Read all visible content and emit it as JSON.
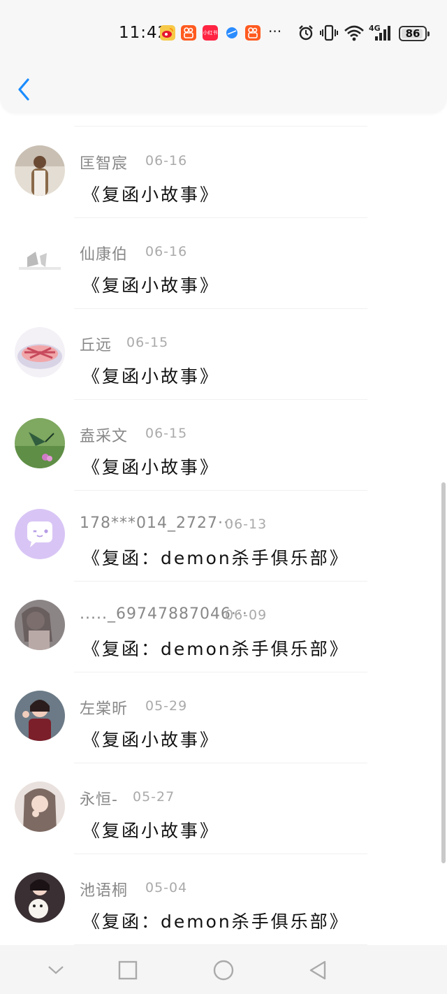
{
  "status_bar": {
    "time": "11:42",
    "app_icons": [
      {
        "name": "weibo-icon",
        "color": "#f5c518"
      },
      {
        "name": "kuaishou-icon",
        "color": "#ff5a1f"
      },
      {
        "name": "xiaohongshu-icon",
        "color": "#ff2442",
        "label": "小红书"
      },
      {
        "name": "browser-icon",
        "color": "#2b8cff"
      },
      {
        "name": "kuaishou-icon",
        "color": "#ff5a1f"
      }
    ],
    "more": "···",
    "network": "4G",
    "battery": "86"
  },
  "header": {
    "back_icon": "chevron-left-icon",
    "accent": "#1a8cff"
  },
  "list": {
    "items": [
      {
        "name": "匡智宸",
        "date": "06-16",
        "title": "《复函小故事》",
        "avatar": "woman-photo"
      },
      {
        "name": "仙康伯",
        "date": "06-16",
        "title": "《复函小故事》",
        "avatar": "landscape-photo"
      },
      {
        "name": "丘远",
        "date": "06-15",
        "title": "《复函小故事》",
        "avatar": "food-photo"
      },
      {
        "name": "盍采文",
        "date": "06-15",
        "title": "《复函小故事》",
        "avatar": "bird-photo"
      },
      {
        "name": "178***014_2727···",
        "date": "06-13",
        "title": "《复函：demon杀手俱乐部》",
        "avatar": "default-chat-avatar"
      },
      {
        "name": "....._69747887046···",
        "date": "06-09",
        "title": "《复函：demon杀手俱乐部》",
        "avatar": "portrait-photo"
      },
      {
        "name": "左棠昕",
        "date": "05-29",
        "title": "《复函小故事》",
        "avatar": "girl-photo"
      },
      {
        "name": "永恒-",
        "date": "05-27",
        "title": "《复函小故事》",
        "avatar": "girl-photo-2"
      },
      {
        "name": "池语桐",
        "date": "05-04",
        "title": "《复函：demon杀手俱乐部》",
        "avatar": "girl-with-dog-photo"
      }
    ]
  },
  "nav_bar": {
    "buttons": [
      "chevron-down-icon",
      "recent-apps-icon",
      "home-icon",
      "back-triangle-icon"
    ]
  }
}
